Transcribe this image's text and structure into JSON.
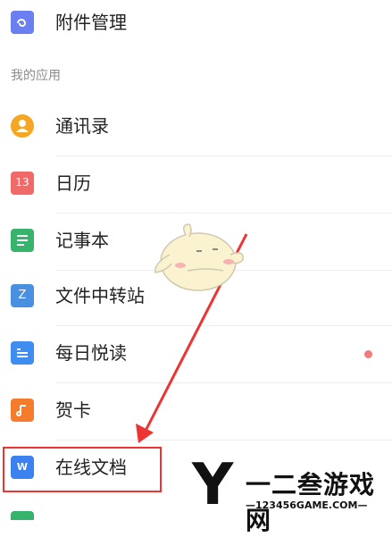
{
  "top_item": {
    "label": "附件管理",
    "icon": "attachment-icon",
    "color": "#6b7ff0"
  },
  "section_title": "我的应用",
  "apps": [
    {
      "label": "通讯录",
      "icon": "contacts-icon",
      "color": "#f5a623"
    },
    {
      "label": "日历",
      "icon": "calendar-icon",
      "color": "#f06a6a",
      "icon_text": "13"
    },
    {
      "label": "记事本",
      "icon": "notepad-icon",
      "color": "#37b36b"
    },
    {
      "label": "文件中转站",
      "icon": "file-transfer-icon",
      "color": "#4a90e2",
      "icon_text": "Z"
    },
    {
      "label": "每日悦读",
      "icon": "daily-read-icon",
      "color": "#3d8ef0",
      "badge_color": "#f07b7b"
    },
    {
      "label": "贺卡",
      "icon": "greeting-card-icon",
      "color": "#f57c2c"
    },
    {
      "label": "在线文档",
      "icon": "online-doc-icon",
      "color": "#3b82f0",
      "icon_text": "W"
    }
  ],
  "watermark": {
    "logo": "Y",
    "text": "一二叁游戏网",
    "domain": "—123456GAME.COM—"
  },
  "colors": {
    "highlight": "#e33333"
  }
}
